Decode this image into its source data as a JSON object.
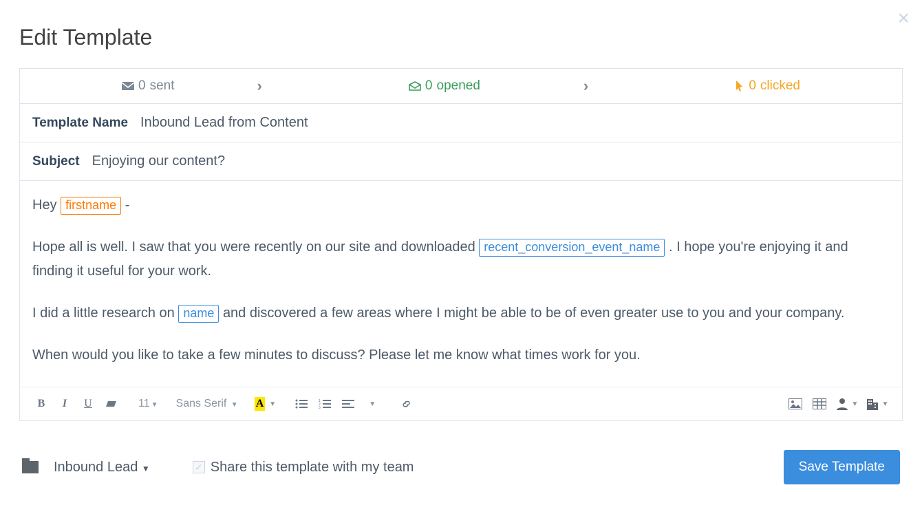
{
  "dialog": {
    "title": "Edit Template"
  },
  "stats": {
    "sent": {
      "count": "0",
      "label": "sent"
    },
    "opened": {
      "count": "0",
      "label": "opened"
    },
    "clicked": {
      "count": "0",
      "label": "clicked"
    }
  },
  "fields": {
    "templateName": {
      "label": "Template Name",
      "value": "Inbound Lead from Content"
    },
    "subject": {
      "label": "Subject",
      "value": "Enjoying our content?"
    }
  },
  "body": {
    "p1_pre": "Hey ",
    "token_firstname": "firstname",
    "p1_post": " -",
    "p2_pre": "Hope all is well. I saw that you were recently on our site and downloaded ",
    "token_event": "recent_conversion_event_name",
    "p2_post": ". I hope you're enjoying it and finding it useful for your work.",
    "p3_pre": "I did a little research on ",
    "token_name": "name",
    "p3_post": " and discovered a few areas where I might be able to be of even greater use to you and your company.",
    "p4": "When would you like to take a few minutes to discuss? Please let me know what times work for you."
  },
  "toolbar": {
    "fontSize": "11",
    "fontFamily": "Sans Serif",
    "fontColorGlyph": "A"
  },
  "footer": {
    "folder": "Inbound Lead",
    "shareLabel": "Share this template with my team",
    "saveLabel": "Save Template"
  }
}
